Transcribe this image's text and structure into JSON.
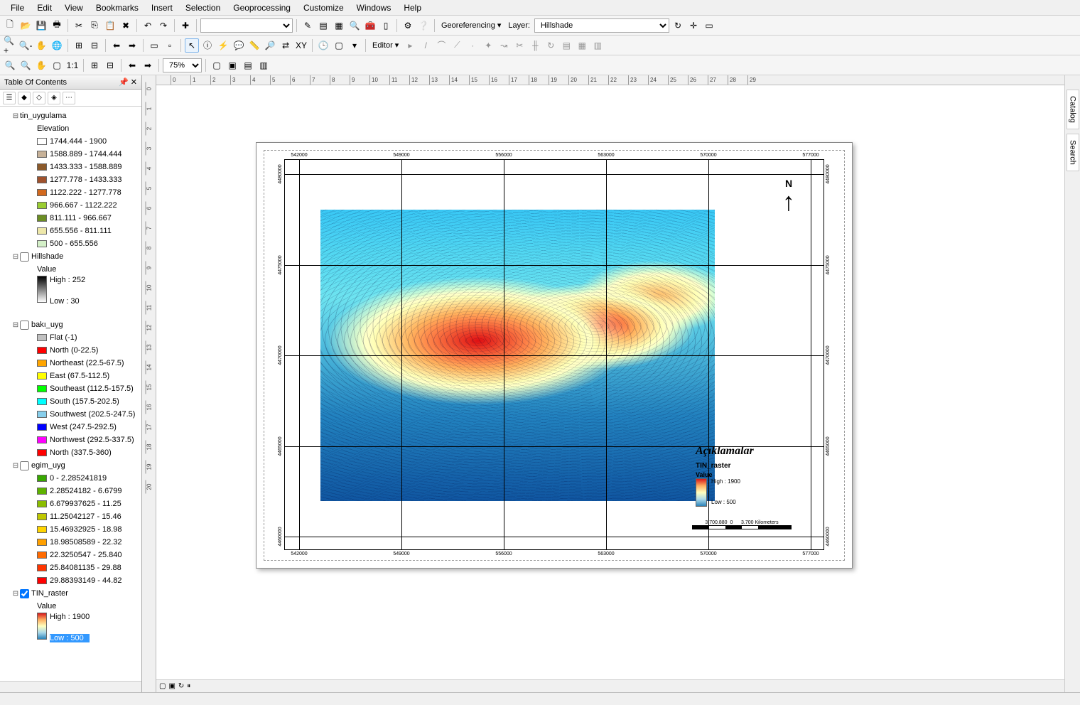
{
  "menu": [
    "File",
    "Edit",
    "View",
    "Bookmarks",
    "Insert",
    "Selection",
    "Geoprocessing",
    "Customize",
    "Windows",
    "Help"
  ],
  "toolbar2": {
    "georef": "Georeferencing ▾",
    "layer_label": "Layer:",
    "layer_value": "Hillshade"
  },
  "toolbar3": {
    "editor": "Editor ▾"
  },
  "zoom": "75%",
  "toc": {
    "title": "Table Of Contents",
    "layers": {
      "tin_uygulama": {
        "name": "tin_uygulama",
        "field": "Elevation",
        "classes": [
          {
            "color": "#ffffff",
            "label": "1744.444 - 1900"
          },
          {
            "color": "#c7b299",
            "label": "1588.889 - 1744.444"
          },
          {
            "color": "#8b5a2b",
            "label": "1433.333 - 1588.889"
          },
          {
            "color": "#a0522d",
            "label": "1277.778 - 1433.333"
          },
          {
            "color": "#d2691e",
            "label": "1122.222 - 1277.778"
          },
          {
            "color": "#9acd32",
            "label": "966.667 - 1122.222"
          },
          {
            "color": "#6b8e23",
            "label": "811.111 - 966.667"
          },
          {
            "color": "#eee8aa",
            "label": "655.556 - 811.111"
          },
          {
            "color": "#d4f0c8",
            "label": "500 - 655.556"
          }
        ]
      },
      "hillshade": {
        "name": "Hillshade",
        "field": "Value",
        "high": "High : 252",
        "low": "Low : 30"
      },
      "baki_uyg": {
        "name": "bakı_uyg",
        "classes": [
          {
            "color": "#c0c0c0",
            "label": "Flat (-1)"
          },
          {
            "color": "#ff0000",
            "label": "North (0-22.5)"
          },
          {
            "color": "#ffa500",
            "label": "Northeast (22.5-67.5)"
          },
          {
            "color": "#ffff00",
            "label": "East (67.5-112.5)"
          },
          {
            "color": "#00ff00",
            "label": "Southeast (112.5-157.5)"
          },
          {
            "color": "#00ffff",
            "label": "South (157.5-202.5)"
          },
          {
            "color": "#87ceeb",
            "label": "Southwest (202.5-247.5)"
          },
          {
            "color": "#0000ff",
            "label": "West (247.5-292.5)"
          },
          {
            "color": "#ff00ff",
            "label": "Northwest (292.5-337.5)"
          },
          {
            "color": "#ff0000",
            "label": "North (337.5-360)"
          }
        ]
      },
      "egim_uyg": {
        "name": "egim_uyg",
        "classes": [
          {
            "color": "#38a800",
            "label": "0 - 2.285241819"
          },
          {
            "color": "#5eb200",
            "label": "2.28524182 - 6.6799"
          },
          {
            "color": "#8abd00",
            "label": "6.679937625 - 11.25"
          },
          {
            "color": "#bfc800",
            "label": "11.25042127 - 15.46"
          },
          {
            "color": "#ffd400",
            "label": "15.46932925 - 18.98"
          },
          {
            "color": "#ffa000",
            "label": "18.98508589 - 22.32"
          },
          {
            "color": "#ff6a00",
            "label": "22.3250547 - 25.840"
          },
          {
            "color": "#ff3500",
            "label": "25.84081135 - 29.88"
          },
          {
            "color": "#ff0000",
            "label": "29.88393149 - 44.82"
          }
        ]
      },
      "tin_raster": {
        "name": "TIN_raster",
        "field": "Value",
        "high": "High : 1900",
        "low": "Low : 500"
      }
    }
  },
  "layout": {
    "hruler_ticks": [
      "0",
      "1",
      "2",
      "3",
      "4",
      "5",
      "6",
      "7",
      "8",
      "9",
      "10",
      "11",
      "12",
      "13",
      "14",
      "15",
      "16",
      "17",
      "18",
      "19",
      "20",
      "21",
      "22",
      "23",
      "24",
      "25",
      "26",
      "27",
      "28",
      "29"
    ],
    "vruler_ticks": [
      "0",
      "1",
      "2",
      "3",
      "4",
      "5",
      "6",
      "7",
      "8",
      "9",
      "10",
      "11",
      "12",
      "13",
      "14",
      "15",
      "16",
      "17",
      "18",
      "19",
      "20"
    ],
    "grid_x": [
      "542000",
      "549000",
      "556000",
      "563000",
      "570000",
      "577000"
    ],
    "grid_y": [
      "4460000",
      "4465000",
      "4470000",
      "4475000",
      "4480000"
    ],
    "north_label": "N",
    "legend": {
      "title": "Açıklamalar",
      "layer": "TIN_raster",
      "field": "Value",
      "high": "High : 1900",
      "low": "Low : 500"
    },
    "scale": {
      "ratio": "3.700.880",
      "unit": "Kilometers",
      "ticks": [
        "0",
        "3.700"
      ]
    }
  },
  "sidetabs": [
    "Catalog",
    "Search"
  ]
}
